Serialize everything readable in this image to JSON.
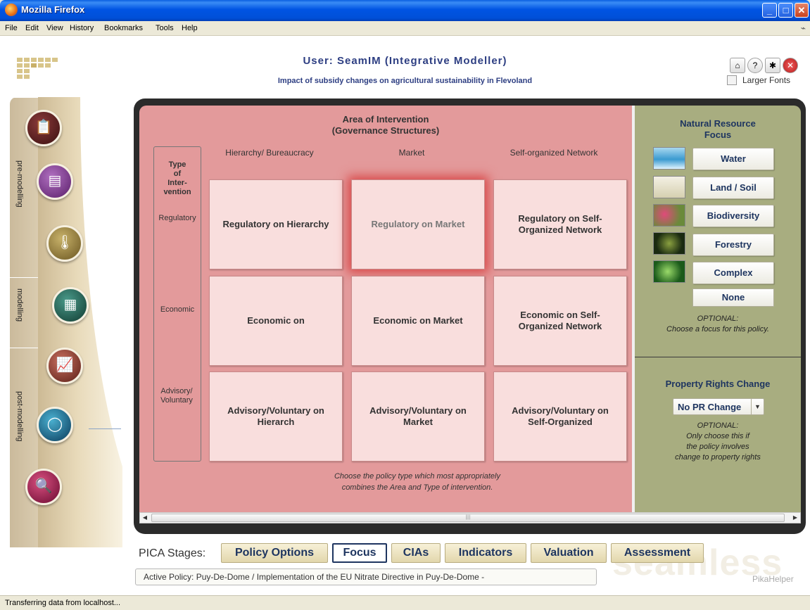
{
  "window": {
    "title": "Mozilla Firefox"
  },
  "menu": [
    "File",
    "Edit",
    "View",
    "History",
    "Bookmarks",
    "Tools",
    "Help"
  ],
  "header": {
    "user": "User: SeamIM (Integrative Modeller)",
    "subtitle": "Impact of subsidy changes on agricultural sustainability in Flevoland",
    "larger_fonts": "Larger Fonts",
    "icons": [
      "home-icon",
      "help-icon",
      "bug-icon",
      "close-icon"
    ]
  },
  "rail": {
    "sections": [
      "pre-modelling",
      "modelling",
      "post-modelling"
    ],
    "buttons": [
      "clipboard-icon",
      "document-icon",
      "thermometer-icon",
      "calculator-icon",
      "chart-icon",
      "globe-icon",
      "search-icon"
    ]
  },
  "intervention": {
    "title_line1": "Area of Intervention",
    "title_line2": "(Governance Structures)",
    "columns": [
      "Hierarchy/ Bureaucracy",
      "Market",
      "Self-organized Network"
    ],
    "type_label_1": "Type",
    "type_label_2": "of",
    "type_label_3": "Inter-",
    "type_label_4": "vention",
    "rows": [
      "Regulatory",
      "Economic",
      "Advisory/ Voluntary"
    ],
    "cells": [
      [
        "Regulatory on Hierarchy",
        "Regulatory on Market",
        "Regulatory on Self-Organized Network"
      ],
      [
        "Economic on",
        "Economic on Market",
        "Economic on Self-Organized Network"
      ],
      [
        "Advisory/Voluntary on Hierarch",
        "Advisory/Voluntary on Market",
        "Advisory/Voluntary on Self-Organized"
      ]
    ],
    "selected": "Regulatory on Market",
    "hint_line1": "Choose the policy type which most appropriately",
    "hint_line2": "combines the Area and Type of intervention."
  },
  "focus": {
    "title_line1": "Natural Resource",
    "title_line2": "Focus",
    "options": [
      "Water",
      "Land / Soil",
      "Biodiversity",
      "Forestry",
      "Complex"
    ],
    "none": "None",
    "optional_1": "OPTIONAL:",
    "optional_2": "Choose a focus for this policy."
  },
  "property_rights": {
    "title": "Property Rights Change",
    "value": "No PR Change",
    "optional_1": "OPTIONAL:",
    "optional_2": "Only choose this if",
    "optional_3": "the policy involves",
    "optional_4": "change to property rights"
  },
  "stages": {
    "label": "PICA Stages:",
    "items": [
      "Policy Options",
      "Focus",
      "CIAs",
      "Indicators",
      "Valuation",
      "Assessment"
    ],
    "selected": "Focus"
  },
  "active_policy": "Active Policy: Puy-De-Dome / Implementation of the EU Nitrate Directive in Puy-De-Dome -",
  "watermark": "seamless",
  "helper": "PikaHelper",
  "status": "Transferring data from localhost..."
}
